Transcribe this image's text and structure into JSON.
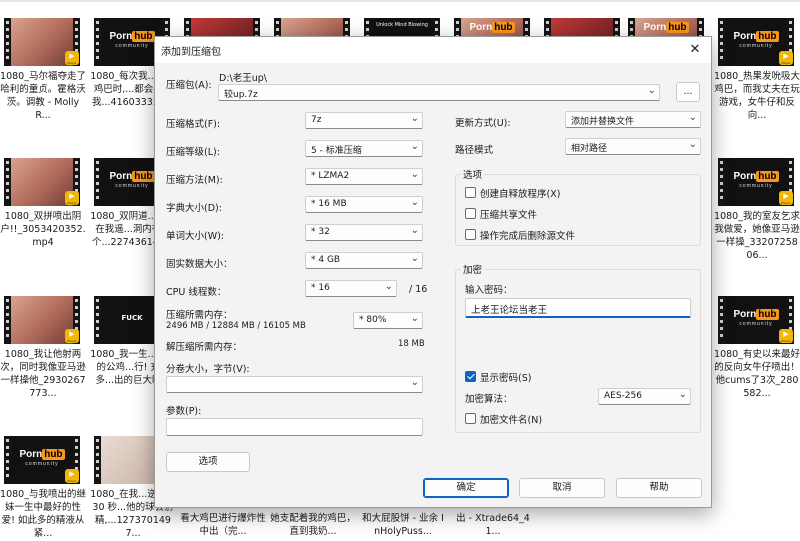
{
  "background": {
    "items": [
      {
        "caption": "1080_马尔福夺走了哈利的童贞。霍格沃茨。调教 - MollyR...",
        "thumb": "skin",
        "logo": false,
        "badge": true
      },
      {
        "caption": "1080_每次我...他的鸡巴时,...都会射出我...416033350...",
        "thumb": "dark",
        "logo": true,
        "badge": true
      },
      {
        "caption": "1080_热果发吮吸大鸡巴，而我丈夫在玩游戏，女牛仔和反向...",
        "thumb": "dark",
        "logo": true,
        "badge": true
      },
      {
        "caption": "1080_双拼喷出阴户!!_3053420352.mp4",
        "thumb": "skin",
        "logo": false,
        "badge": true
      },
      {
        "caption": "1080_双阴道...入，在我遥...洞内有多个...227436143...",
        "thumb": "dark",
        "logo": true,
        "badge": true
      },
      {
        "caption": "1080_我的室友乞求我做爱，她像亚马逊一样操_3320725806...",
        "thumb": "dark",
        "logo": true,
        "badge": true
      },
      {
        "caption": "1080_我让他射两次，同时我像亚马逊一样操他_2930267773...",
        "thumb": "skin",
        "logo": false,
        "badge": true
      },
      {
        "caption": "1080_我一生...最好的公鸡...行! 充满多...出的巨大睫...",
        "thumb": "dark",
        "logo": false,
        "badge": false,
        "plain": "FUCK"
      },
      {
        "caption": "1080_有史以来最好的反向女牛仔喷出！ 他cums了3次_280582...",
        "thumb": "dark",
        "logo": true,
        "badge": true
      },
      {
        "caption": "1080_与我喷出的继妹一生中最好的性爱! 如此多的精液从紧...",
        "thumb": "dark",
        "logo": true,
        "badge": true
      },
      {
        "caption": "1080_在我...逆操他 30 秒...他的球会射精,...1273701497...",
        "thumb": "pale",
        "logo": false,
        "badge": true
      },
      {
        "caption": "看大鸡巴进行爆炸性中出（完...",
        "thumb": "none",
        "logo": false,
        "badge": false
      },
      {
        "caption": "她支配着我的鸡巴，直到我奶...",
        "thumb": "none",
        "logo": false,
        "badge": false
      },
      {
        "caption": "和大屁股饼 - 业余 InHolyPuss...",
        "thumb": "none",
        "logo": false,
        "badge": false
      },
      {
        "caption": "出 - Xtrade64_41...",
        "thumb": "none",
        "logo": false,
        "badge": false
      }
    ],
    "logo_text": {
      "porn": "Porn",
      "hub": "hub",
      "community": "community"
    },
    "badge_text": "Player",
    "top_thumb_text": "Unlock Mind Blowing"
  },
  "dialog": {
    "title": "添加到压缩包",
    "archive_label": "压缩包(A):",
    "archive_dir": "D:\\老王up\\",
    "archive_name": "较up.7z",
    "browse_label": "...",
    "format_label": "压缩格式(F):",
    "format_value": "7z",
    "level_label": "压缩等级(L):",
    "level_value": "5 - 标准压缩",
    "method_label": "压缩方法(M):",
    "method_value": "* LZMA2",
    "dict_label": "字典大小(D):",
    "dict_value": "* 16 MB",
    "word_label": "单词大小(W):",
    "word_value": "* 32",
    "solid_label": "固实数据大小：",
    "solid_value": "* 4 GB",
    "threads_label": "CPU 线程数：",
    "threads_value": "* 16",
    "threads_total": "/ 16",
    "mem_comp_label": "压缩所需内存：",
    "mem_comp_value": "2496 MB / 12884 MB / 16105 MB",
    "mem_pct_value": "* 80%",
    "mem_decomp_label": "解压缩所需内存：",
    "mem_decomp_value": "18 MB",
    "split_label": "分卷大小，字节(V):",
    "split_value": "",
    "params_label": "参数(P):",
    "params_value": "",
    "options_button": "选项",
    "update_label": "更新方式(U):",
    "update_value": "添加并替换文件",
    "path_label": "路径模式",
    "path_value": "相对路径",
    "options_group_title": "选项",
    "opt_sfx": "创建自释放程序(X)",
    "opt_shared": "压缩共享文件",
    "opt_delete": "操作完成后删除源文件",
    "encrypt_group_title": "加密",
    "password_label": "输入密码：",
    "password_value": "上老王论坛当老王",
    "show_password": "显示密码(S)",
    "encrypt_method_label": "加密算法：",
    "encrypt_method_value": "AES-256",
    "encrypt_names": "加密文件名(N)",
    "ok_button": "确定",
    "cancel_button": "取消",
    "help_button": "帮助",
    "accent_color": "#0f63c4"
  }
}
